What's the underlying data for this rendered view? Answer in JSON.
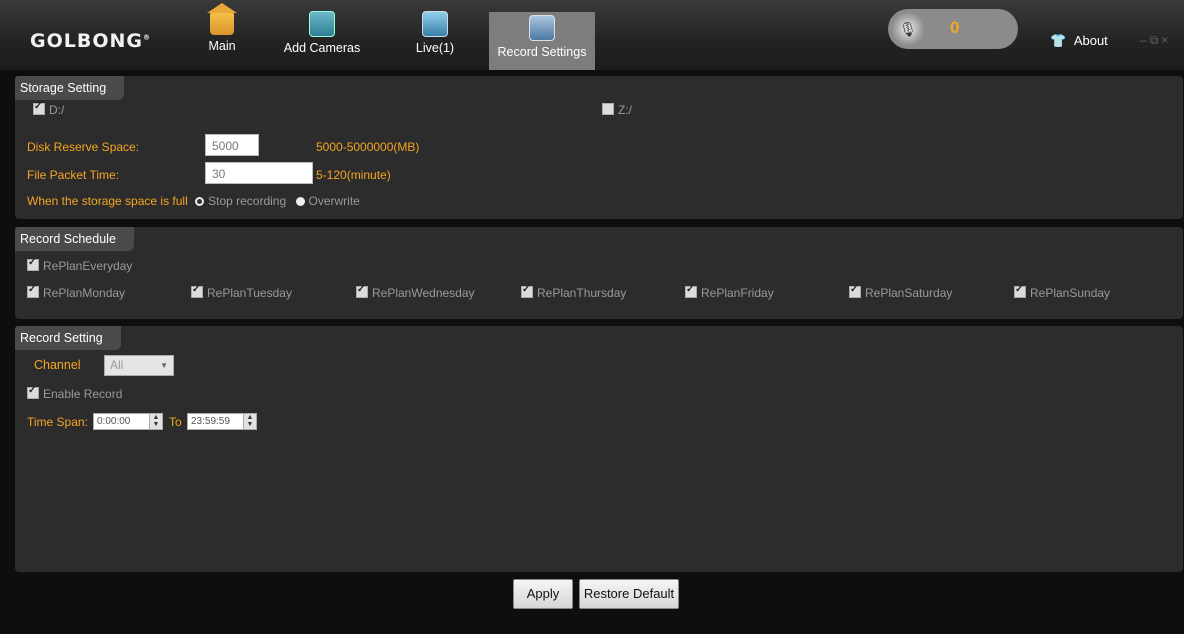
{
  "app": {
    "logo": "GOLBONG",
    "nav": [
      {
        "label": "Main",
        "icon": "home-icon"
      },
      {
        "label": "Add Cameras",
        "icon": "add-camera-icon"
      },
      {
        "label": "Live(1)",
        "icon": "live-icon"
      },
      {
        "label": "Record Settings",
        "icon": "record-settings-icon",
        "active": true
      }
    ],
    "mic_count": "0",
    "about_label": "About"
  },
  "storage": {
    "title": "Storage Setting",
    "drives": [
      {
        "label": "D:/",
        "checked": true
      },
      {
        "label": "Z:/",
        "checked": false
      }
    ],
    "disk_reserve_label": "Disk Reserve Space:",
    "disk_reserve_value": "5000",
    "disk_reserve_range": "5000-5000000(MB)",
    "file_packet_label": "File Packet Time:",
    "file_packet_value": "30",
    "file_packet_range": "5-120(minute)",
    "full_label": "When the storage space is full",
    "full_options": [
      {
        "label": "Stop recording",
        "selected": true
      },
      {
        "label": "Overwrite",
        "selected": false
      }
    ]
  },
  "schedule": {
    "title": "Record Schedule",
    "everyday": {
      "label": "RePlanEveryday",
      "checked": true
    },
    "days": [
      {
        "label": "RePlanMonday",
        "checked": true
      },
      {
        "label": "RePlanTuesday",
        "checked": true
      },
      {
        "label": "RePlanWednesday",
        "checked": true
      },
      {
        "label": "RePlanThursday",
        "checked": true
      },
      {
        "label": "RePlanFriday",
        "checked": true
      },
      {
        "label": "RePlanSaturday",
        "checked": true
      },
      {
        "label": "RePlanSunday",
        "checked": true
      }
    ]
  },
  "record": {
    "title": "Record Setting",
    "channel_label": "Channel",
    "channel_value": "All",
    "enable_label": "Enable Record",
    "enable_checked": true,
    "time_span_label": "Time Span:",
    "time_from": "0:00:00",
    "to_label": "To",
    "time_to": "23:59:59"
  },
  "actions": {
    "apply": "Apply",
    "restore": "Restore Default"
  },
  "colors": {
    "accent": "#f5a623",
    "panel": "#2c2c2c",
    "background": "#0e0e0e"
  }
}
